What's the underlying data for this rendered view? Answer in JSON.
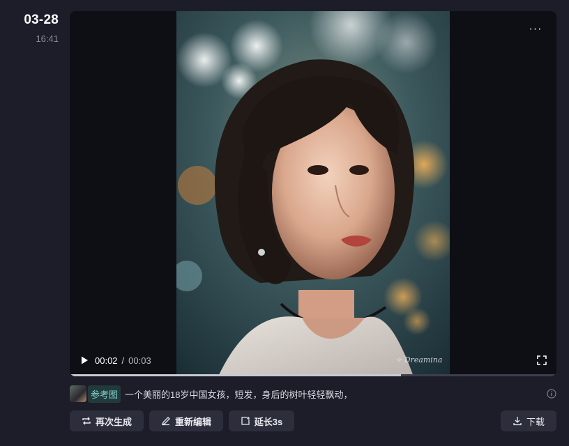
{
  "entry": {
    "date": "03-28",
    "time": "16:41"
  },
  "video": {
    "current_time": "00:02",
    "separator": "/",
    "total_time": "00:03",
    "progress": 0.68,
    "watermark": "✧ Dreamina",
    "more_glyph": "···"
  },
  "prompt": {
    "reference_label": "参考图",
    "text": "一个美丽的18岁中国女孩，短发，身后的树叶轻轻飘动，"
  },
  "actions": {
    "regenerate": "再次生成",
    "reedit": "重新编辑",
    "extend": "延长3s",
    "download": "下载"
  },
  "colors": {
    "background": "#1c1d29",
    "button_bg": "#2c2e3b",
    "reference_chip": "#7fd3cf"
  }
}
